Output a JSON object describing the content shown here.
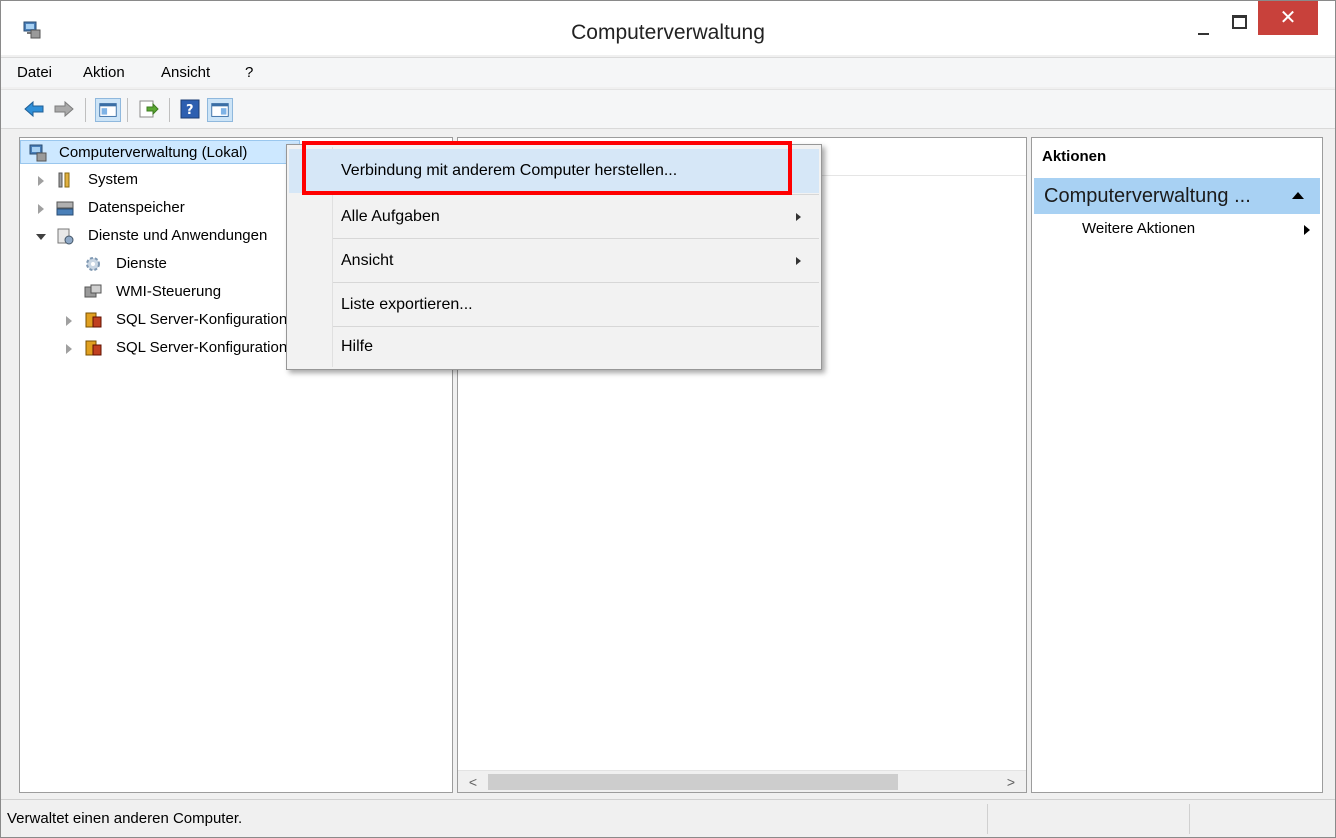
{
  "window": {
    "title": "Computerverwaltung",
    "close_glyph": "✕"
  },
  "menu": {
    "items": [
      "Datei",
      "Aktion",
      "Ansicht",
      "?"
    ]
  },
  "toolbar": {
    "buttons": [
      {
        "icon": "back-arrow-icon"
      },
      {
        "icon": "forward-arrow-icon"
      },
      {
        "icon": "show-hide-console-tree-icon"
      },
      {
        "icon": "export-list-icon"
      },
      {
        "icon": "help-icon"
      },
      {
        "icon": "show-hide-action-pane-icon"
      }
    ]
  },
  "tree": {
    "items": [
      {
        "label": "Computerverwaltung (Lokal)",
        "selected": true
      },
      {
        "label": "System"
      },
      {
        "label": "Datenspeicher"
      },
      {
        "label": "Dienste und Anwendungen",
        "expanded": true
      },
      {
        "label": "Dienste"
      },
      {
        "label": "WMI-Steuerung"
      },
      {
        "label": "SQL Server-Konfigurationsmanager"
      },
      {
        "label": "SQL Server-Konfigurationsmanager"
      }
    ]
  },
  "context_menu": {
    "items": [
      {
        "label": "Verbindung mit anderem Computer herstellen...",
        "highlighted": true
      },
      {
        "label": "Alle Aufgaben",
        "submenu": true
      },
      {
        "label": "Ansicht",
        "submenu": true
      },
      {
        "label": "Liste exportieren..."
      },
      {
        "label": "Hilfe"
      }
    ]
  },
  "center": {
    "scroll_left": "<",
    "scroll_right": ">"
  },
  "actions": {
    "header": "Aktionen",
    "section": "Computerverwaltung ...",
    "item": "Weitere Aktionen"
  },
  "status": {
    "text": "Verwaltet einen anderen Computer."
  },
  "colors": {
    "accent": "#a8d1f3",
    "close_red": "#c8413b",
    "highlight_border": "#ff0000"
  }
}
